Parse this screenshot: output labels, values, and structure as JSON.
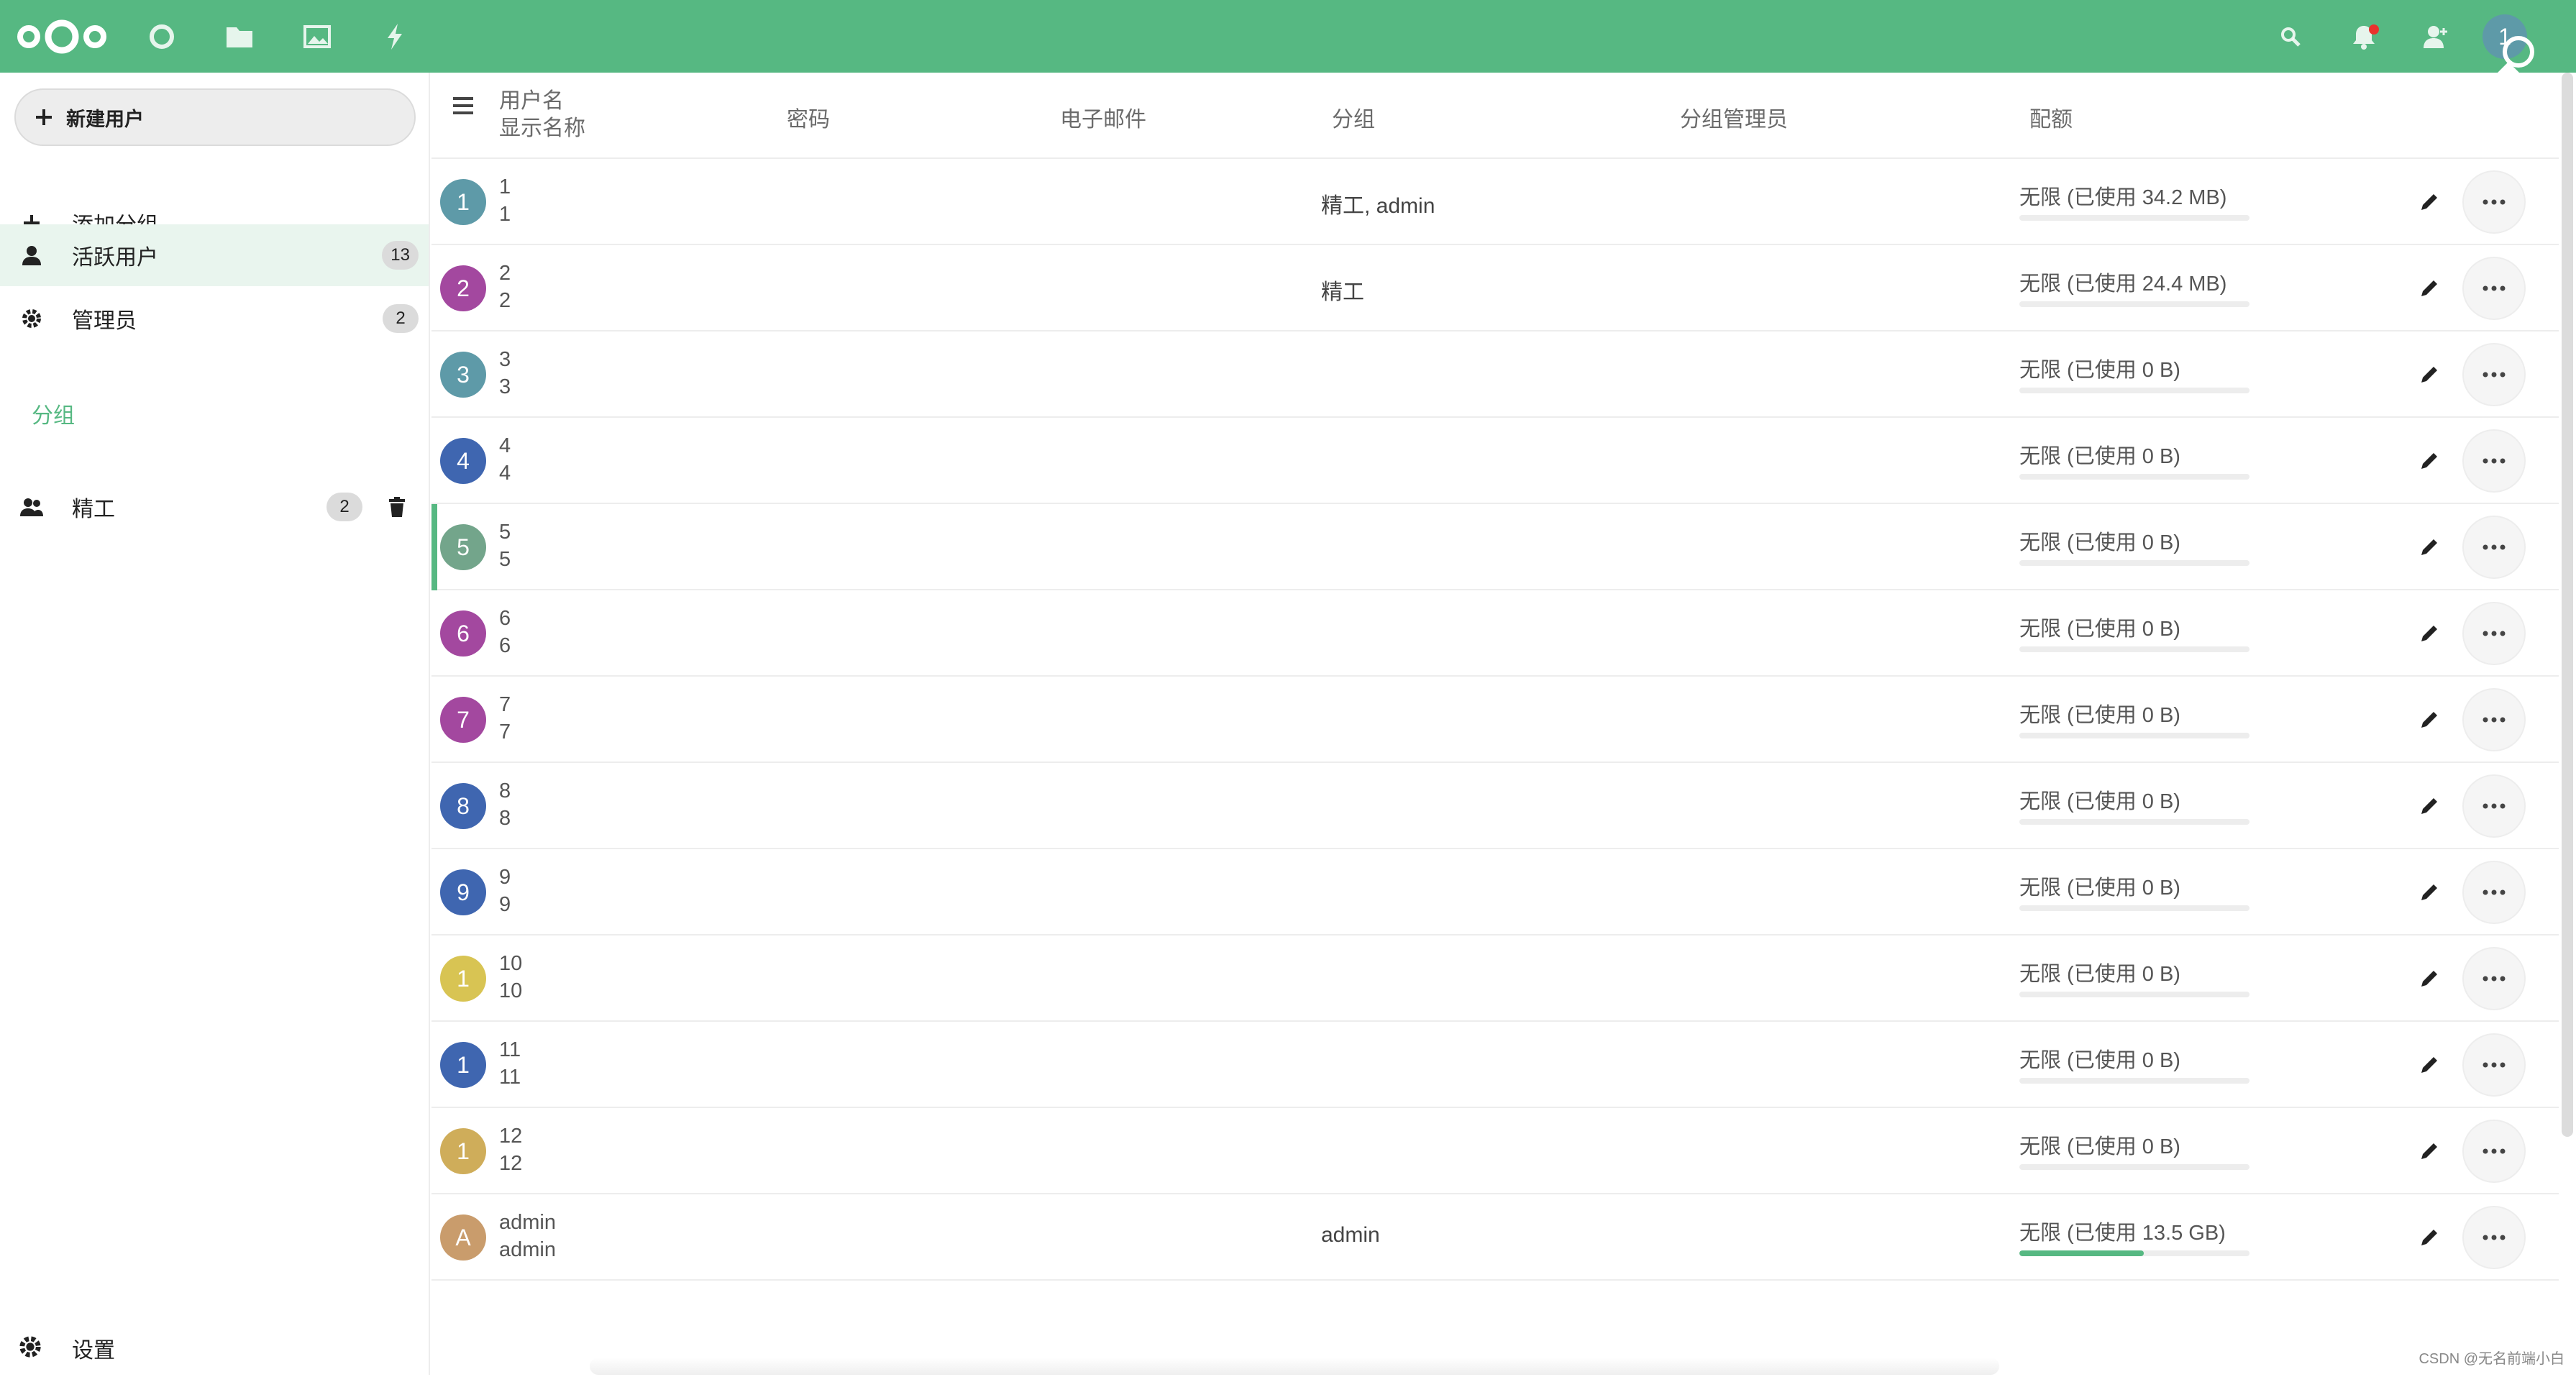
{
  "header": {
    "icons": [
      "nextcloud-logo",
      "dashboard-icon",
      "files-icon",
      "photos-icon",
      "activity-icon",
      "search-icon",
      "notifications-icon",
      "contacts-icon"
    ],
    "avatar_letter": "1",
    "accent": "#56b882"
  },
  "sidebar": {
    "new_user_label": "新建用户",
    "add_group_label": "添加分组",
    "active_users_label": "活跃用户",
    "active_users_count": "13",
    "admins_label": "管理员",
    "admins_count": "2",
    "groups_caption": "分组",
    "group_items": [
      {
        "label": "精工",
        "count": "2"
      }
    ],
    "settings_label": "设置"
  },
  "table": {
    "headers": {
      "username": "用户名",
      "display_name": "显示名称",
      "password": "密码",
      "email": "电子邮件",
      "groups": "分组",
      "group_admins": "分组管理员",
      "quota": "配额"
    },
    "rows": [
      {
        "avatar": "1",
        "color": "#5e9aa8",
        "username": "1",
        "display": "1",
        "groups": "精工, admin",
        "quota": "无限 (已使用 34.2 MB)",
        "usage": 0
      },
      {
        "avatar": "2",
        "color": "#a3489f",
        "username": "2",
        "display": "2",
        "groups": "精工",
        "quota": "无限 (已使用 24.4 MB)",
        "usage": 0
      },
      {
        "avatar": "3",
        "color": "#5e9aa8",
        "username": "3",
        "display": "3",
        "groups": "",
        "quota": "无限 (已使用 0 B)",
        "usage": 0
      },
      {
        "avatar": "4",
        "color": "#3f66b0",
        "username": "4",
        "display": "4",
        "groups": "",
        "quota": "无限 (已使用 0 B)",
        "usage": 0
      },
      {
        "avatar": "5",
        "color": "#73a58b",
        "username": "5",
        "display": "5",
        "groups": "",
        "quota": "无限 (已使用 0 B)",
        "usage": 0
      },
      {
        "avatar": "6",
        "color": "#a3489f",
        "username": "6",
        "display": "6",
        "groups": "",
        "quota": "无限 (已使用 0 B)",
        "usage": 0
      },
      {
        "avatar": "7",
        "color": "#a3489f",
        "username": "7",
        "display": "7",
        "groups": "",
        "quota": "无限 (已使用 0 B)",
        "usage": 0
      },
      {
        "avatar": "8",
        "color": "#3f66b0",
        "username": "8",
        "display": "8",
        "groups": "",
        "quota": "无限 (已使用 0 B)",
        "usage": 0
      },
      {
        "avatar": "9",
        "color": "#3f66b0",
        "username": "9",
        "display": "9",
        "groups": "",
        "quota": "无限 (已使用 0 B)",
        "usage": 0
      },
      {
        "avatar": "1",
        "color": "#d8c453",
        "username": "10",
        "display": "10",
        "groups": "",
        "quota": "无限 (已使用 0 B)",
        "usage": 0
      },
      {
        "avatar": "1",
        "color": "#3f66b0",
        "username": "11",
        "display": "11",
        "groups": "",
        "quota": "无限 (已使用 0 B)",
        "usage": 0
      },
      {
        "avatar": "1",
        "color": "#cfad5a",
        "username": "12",
        "display": "12",
        "groups": "",
        "quota": "无限 (已使用 0 B)",
        "usage": 0
      },
      {
        "avatar": "A",
        "color": "#c99c6c",
        "username": "admin",
        "display": "admin",
        "groups": "admin",
        "quota": "无限 (已使用 13.5 GB)",
        "usage": 0.54
      }
    ]
  },
  "watermark": "CSDN @无名前端小白"
}
